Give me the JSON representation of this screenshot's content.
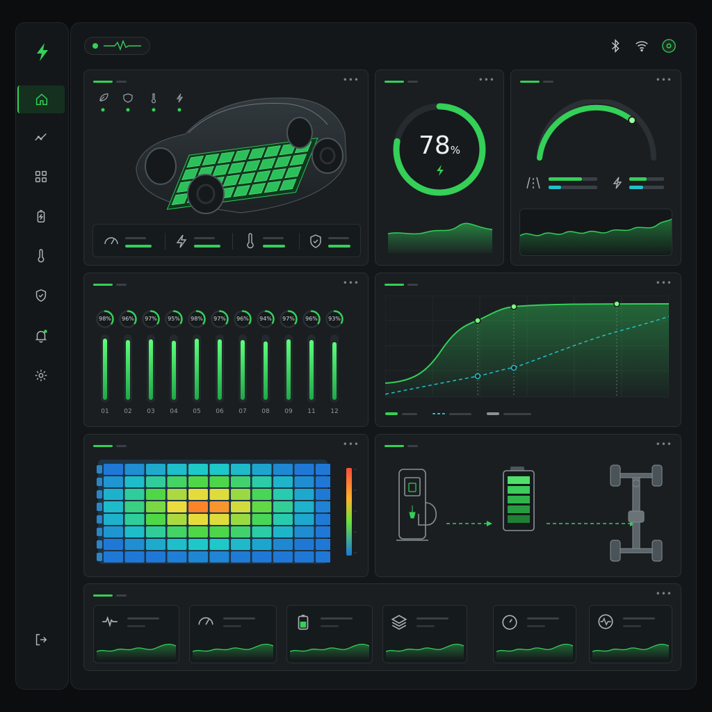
{
  "colors": {
    "accent": "#34d058",
    "accent_glow": "#5dff7a",
    "teal": "#22c1c8",
    "panel": "#1a1e21",
    "bg": "#0b0d0e"
  },
  "sidebar": {
    "logo": "lightning-bolt-icon",
    "items": [
      {
        "icon": "home-icon",
        "active": true
      },
      {
        "icon": "trend-chart-icon"
      },
      {
        "icon": "grid-icon"
      },
      {
        "icon": "battery-icon"
      },
      {
        "icon": "thermometer-icon"
      },
      {
        "icon": "shield-check-icon"
      },
      {
        "icon": "bell-icon",
        "badge": true
      },
      {
        "icon": "gear-icon"
      }
    ],
    "logout_icon": "logout-icon"
  },
  "header": {
    "status_icon": "heartbeat-icon",
    "right_icons": [
      "bluetooth-icon",
      "wifi-icon",
      "power-icon"
    ]
  },
  "soc": {
    "value": "78",
    "unit": "%",
    "fraction": 0.78
  },
  "cells": {
    "percents": [
      "98%",
      "96%",
      "97%",
      "95%",
      "98%",
      "97%",
      "96%",
      "94%",
      "97%",
      "96%",
      "93%"
    ],
    "levels": [
      0.98,
      0.96,
      0.97,
      0.95,
      0.98,
      0.97,
      0.96,
      0.94,
      0.97,
      0.96,
      0.93
    ],
    "labels": [
      "01",
      "02",
      "03",
      "04",
      "05",
      "06",
      "07",
      "08",
      "09",
      "11",
      "12"
    ]
  },
  "heatmap": {
    "rows": 8,
    "cols": 11
  }
}
